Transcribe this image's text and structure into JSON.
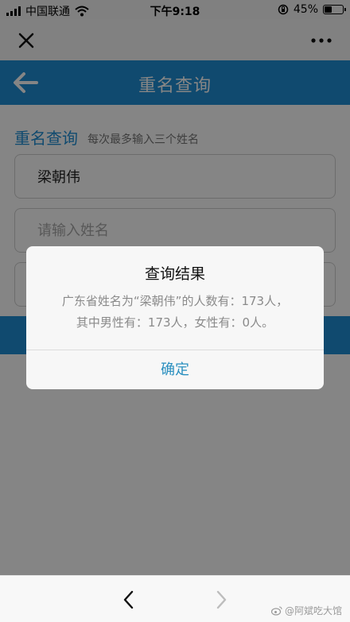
{
  "status_bar": {
    "carrier": "中国联通",
    "time": "下午9:18",
    "battery_percent": "45%",
    "battery_level": 0.45,
    "icons": [
      "signal-icon",
      "wifi-icon",
      "orientation-lock-icon",
      "battery-icon"
    ]
  },
  "webview_bar": {
    "icons": [
      "close-icon",
      "more-icon"
    ]
  },
  "app_header": {
    "title": "重名查询",
    "background": "#1f8fd5"
  },
  "form": {
    "section_title": "重名查询",
    "hint": "每次最多输入三个姓名",
    "inputs": [
      {
        "value": "梁朝伟",
        "placeholder": ""
      },
      {
        "value": "",
        "placeholder": "请输入姓名"
      },
      {
        "value": "",
        "placeholder": ""
      }
    ]
  },
  "dialog": {
    "title": "查询结果",
    "message_line1": "广东省姓名为“梁朝伟”的人数有：173人，",
    "message_line2": "其中男性有：173人，女性有：0人。",
    "ok_label": "确定"
  },
  "bottom_nav": {
    "icons": [
      "nav-back-icon",
      "nav-forward-icon"
    ],
    "watermark": "@阿斌吃大馆"
  }
}
